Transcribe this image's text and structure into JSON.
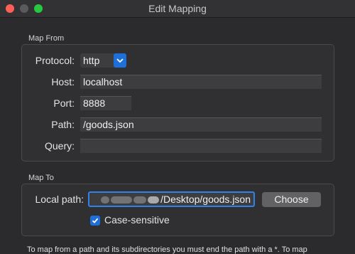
{
  "window": {
    "title": "Edit Mapping"
  },
  "map_from": {
    "section_title": "Map From",
    "protocol": {
      "label": "Protocol:",
      "value": "http"
    },
    "host": {
      "label": "Host:",
      "value": "localhost"
    },
    "port": {
      "label": "Port:",
      "value": "8888"
    },
    "path": {
      "label": "Path:",
      "value": "/goods.json"
    },
    "query": {
      "label": "Query:",
      "value": ""
    }
  },
  "map_to": {
    "section_title": "Map To",
    "local_path": {
      "label": "Local path:",
      "visible_value": "/Desktop/goods.json"
    },
    "choose_button": "Choose",
    "case_sensitive": {
      "label": "Case-sensitive",
      "checked": true
    }
  },
  "footer": {
    "note": "To map from a path and its subdirectories you must end the path with a *. To map"
  },
  "colors": {
    "accent": "#1e6fd9",
    "focus_ring": "#2f82e8",
    "close": "#ff5f57",
    "maximize": "#28c840"
  }
}
